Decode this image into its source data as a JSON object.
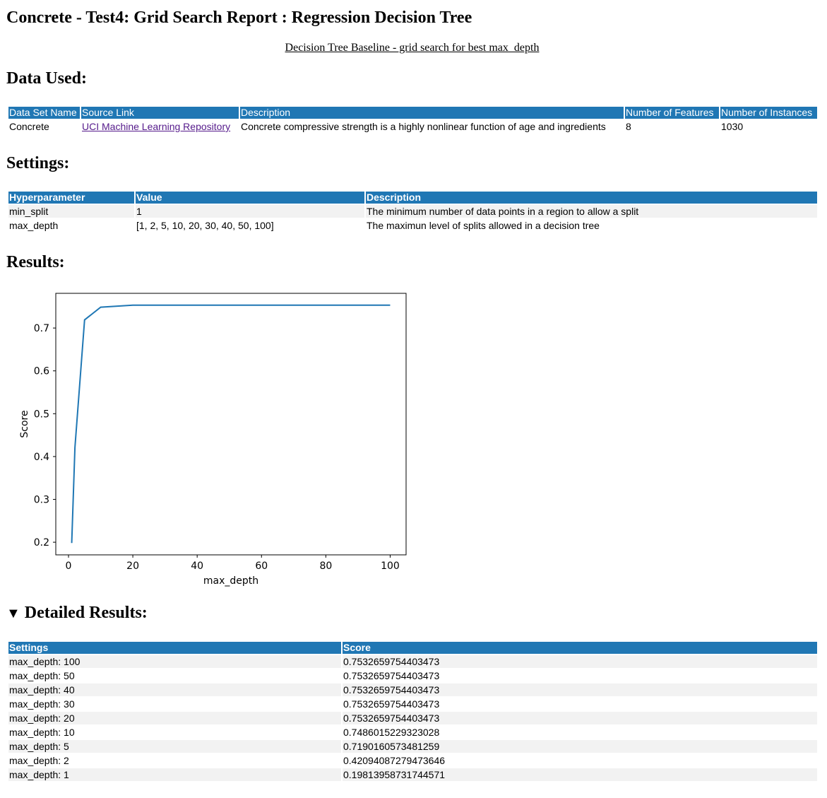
{
  "page": {
    "title": "Concrete - Test4: Grid Search Report : Regression Decision Tree",
    "subtitle_link": "Decision Tree Baseline - grid search for best max_depth"
  },
  "data_used": {
    "heading": "Data Used:",
    "columns": [
      "Data Set Name",
      "Source Link",
      "Description",
      "Number of Features",
      "Number of Instances"
    ],
    "row": {
      "name": "Concrete",
      "source_link": "UCI Machine Learning Repository",
      "description": "Concrete compressive strength is a highly nonlinear function of age and ingredients",
      "features": "8",
      "instances": "1030"
    }
  },
  "settings": {
    "heading": "Settings:",
    "columns": [
      "Hyperparameter",
      "Value",
      "Description"
    ],
    "rows": [
      {
        "param": "min_split",
        "value": "1",
        "description": "The minimum number of data points in a region to allow a split"
      },
      {
        "param": "max_depth",
        "value": "[1, 2, 5, 10, 20, 30, 40, 50, 100]",
        "description": "The maximun level of splits allowed in a decision tree"
      }
    ]
  },
  "results": {
    "heading": "Results:"
  },
  "chart_data": {
    "type": "line",
    "title": "",
    "xlabel": "max_depth",
    "ylabel": "Score",
    "x": [
      1,
      2,
      5,
      10,
      20,
      30,
      40,
      50,
      100
    ],
    "series": [
      {
        "values": [
          0.19813958731744571,
          0.42094087279473646,
          0.7190160573481259,
          0.7486015229323028,
          0.7532659754403473,
          0.7532659754403473,
          0.7532659754403473,
          0.7532659754403473,
          0.7532659754403473
        ]
      }
    ],
    "xticks": [
      0,
      20,
      40,
      60,
      80,
      100
    ],
    "yticks": [
      0.2,
      0.3,
      0.4,
      0.5,
      0.6,
      0.7
    ],
    "xlim": [
      -3.95,
      104.95
    ],
    "ylim": [
      0.1705,
      0.781
    ],
    "grid": false,
    "line_color": "#1f77b4"
  },
  "detailed": {
    "toggle_icon": "triangle-down-icon",
    "heading": "Detailed Results:",
    "columns": [
      "Settings",
      "Score"
    ],
    "rows": [
      {
        "setting": "max_depth: 100",
        "score": "0.7532659754403473"
      },
      {
        "setting": "max_depth: 50",
        "score": "0.7532659754403473"
      },
      {
        "setting": "max_depth: 40",
        "score": "0.7532659754403473"
      },
      {
        "setting": "max_depth: 30",
        "score": "0.7532659754403473"
      },
      {
        "setting": "max_depth: 20",
        "score": "0.7532659754403473"
      },
      {
        "setting": "max_depth: 10",
        "score": "0.7486015229323028"
      },
      {
        "setting": "max_depth: 5",
        "score": "0.7190160573481259"
      },
      {
        "setting": "max_depth: 2",
        "score": "0.42094087279473646"
      },
      {
        "setting": "max_depth: 1",
        "score": "0.19813958731744571"
      }
    ]
  },
  "colors": {
    "header_bg": "#2077b4",
    "row_alt_bg": "#f2f2f2",
    "link_visited": "#551a8b"
  }
}
